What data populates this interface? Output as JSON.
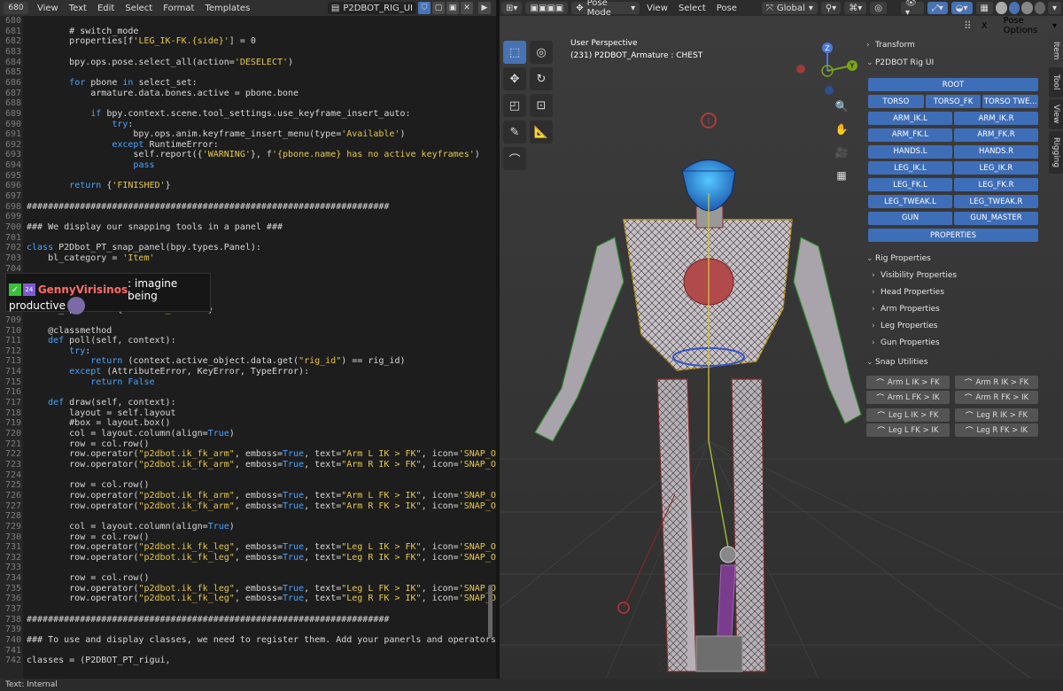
{
  "text_editor": {
    "editor_type": "680",
    "menu": [
      "View",
      "Text",
      "Edit",
      "Select",
      "Format",
      "Templates"
    ],
    "file_name": "P2DBOT_RIG_UI",
    "status": "Text: Internal",
    "lines": [
      {
        "n": "680",
        "t": ""
      },
      {
        "n": "681",
        "t": "        # switch_mode"
      },
      {
        "n": "682",
        "t": "        properties[f'LEG_IK-FK.{side}'] = 0"
      },
      {
        "n": "683",
        "t": ""
      },
      {
        "n": "684",
        "t": "        bpy.ops.pose.select_all(action='DESELECT')"
      },
      {
        "n": "685",
        "t": ""
      },
      {
        "n": "686",
        "t": "        for pbone in select_set:"
      },
      {
        "n": "687",
        "t": "            armature.data.bones.active = pbone.bone"
      },
      {
        "n": "688",
        "t": ""
      },
      {
        "n": "689",
        "t": "            if bpy.context.scene.tool_settings.use_keyframe_insert_auto:"
      },
      {
        "n": "690",
        "t": "                try:"
      },
      {
        "n": "691",
        "t": "                    bpy.ops.anim.keyframe_insert_menu(type='Available')"
      },
      {
        "n": "692",
        "t": "                except RuntimeError:"
      },
      {
        "n": "693",
        "t": "                    self.report({'WARNING'}, f'{pbone.name} has no active keyframes')"
      },
      {
        "n": "694",
        "t": "                    pass"
      },
      {
        "n": "695",
        "t": ""
      },
      {
        "n": "696",
        "t": "        return {'FINISHED'}"
      },
      {
        "n": "697",
        "t": ""
      },
      {
        "n": "698",
        "t": "####################################################################"
      },
      {
        "n": "699",
        "t": ""
      },
      {
        "n": "700",
        "t": "### We display our snapping tools in a panel ###"
      },
      {
        "n": "701",
        "t": ""
      },
      {
        "n": "702",
        "t": "class P2Dbot_PT_snap_panel(bpy.types.Panel):"
      },
      {
        "n": "703",
        "t": "    bl_category = 'Item'"
      },
      {
        "n": "704",
        "t": ""
      },
      {
        "n": "705",
        "t": ""
      },
      {
        "n": "706",
        "t": ""
      },
      {
        "n": "707",
        "t": "    bl_region_type = 'UI'"
      },
      {
        "n": "708",
        "t": "    bl_options = {'DEFAULT_CLOSED'}"
      },
      {
        "n": "709",
        "t": ""
      },
      {
        "n": "710",
        "t": "    @classmethod"
      },
      {
        "n": "711",
        "t": "    def poll(self, context):"
      },
      {
        "n": "712",
        "t": "        try:"
      },
      {
        "n": "713",
        "t": "            return (context.active_object.data.get(\"rig_id\") == rig_id)"
      },
      {
        "n": "714",
        "t": "        except (AttributeError, KeyError, TypeError):"
      },
      {
        "n": "715",
        "t": "            return False"
      },
      {
        "n": "716",
        "t": ""
      },
      {
        "n": "717",
        "t": "    def draw(self, context):"
      },
      {
        "n": "718",
        "t": "        layout = self.layout"
      },
      {
        "n": "719",
        "t": "        #box = layout.box()"
      },
      {
        "n": "720",
        "t": "        col = layout.column(align=True)"
      },
      {
        "n": "721",
        "t": "        row = col.row()"
      },
      {
        "n": "722",
        "t": "        row.operator(\"p2dbot.ik_fk_arm\", emboss=True, text=\"Arm L IK > FK\", icon='SNAP_ON').side"
      },
      {
        "n": "723",
        "t": "        row.operator(\"p2dbot.ik_fk_arm\", emboss=True, text=\"Arm R IK > FK\", icon='SNAP_ON').side"
      },
      {
        "n": "724",
        "t": ""
      },
      {
        "n": "725",
        "t": "        row = col.row()"
      },
      {
        "n": "726",
        "t": "        row.operator(\"p2dbot.ik_fk_arm\", emboss=True, text=\"Arm L FK > IK\", icon='SNAP_ON').side"
      },
      {
        "n": "727",
        "t": "        row.operator(\"p2dbot.ik_fk_arm\", emboss=True, text=\"Arm R FK > IK\", icon='SNAP_ON').side"
      },
      {
        "n": "728",
        "t": ""
      },
      {
        "n": "729",
        "t": "        col = layout.column(align=True)"
      },
      {
        "n": "730",
        "t": "        row = col.row()"
      },
      {
        "n": "731",
        "t": "        row.operator(\"p2dbot.ik_fk_leg\", emboss=True, text=\"Leg L IK > FK\", icon='SNAP_ON').side"
      },
      {
        "n": "732",
        "t": "        row.operator(\"p2dbot.ik_fk_leg\", emboss=True, text=\"Leg R IK > FK\", icon='SNAP_ON').side"
      },
      {
        "n": "733",
        "t": ""
      },
      {
        "n": "734",
        "t": "        row = col.row()"
      },
      {
        "n": "735",
        "t": "        row.operator(\"p2dbot.ik_fk_leg\", emboss=True, text=\"Leg L FK > IK\", icon='SNAP_ON').side"
      },
      {
        "n": "736",
        "t": "        row.operator(\"p2dbot.ik_fk_leg\", emboss=True, text=\"Leg R FK > IK\", icon='SNAP_ON').side"
      },
      {
        "n": "737",
        "t": ""
      },
      {
        "n": "738",
        "t": "####################################################################"
      },
      {
        "n": "739",
        "t": ""
      },
      {
        "n": "740",
        "t": "### To use and display classes, we need to register them. Add your panerls and operators to the"
      },
      {
        "n": "741",
        "t": ""
      },
      {
        "n": "742",
        "t": "classes = (P2DBOT_PT_rigui,"
      }
    ]
  },
  "chat": {
    "username": "GennyVirisinos",
    "message": ": imagine being",
    "message2": "productive",
    "badge2": "24"
  },
  "viewport": {
    "mode": "Pose Mode",
    "menu": [
      "View",
      "Select",
      "Pose"
    ],
    "orientation": "Global",
    "pose_options": "Pose Options",
    "perspective": "User Perspective",
    "object_info": "(231) P2DBOT_Armature : CHEST",
    "gizmo": {
      "z": "Z",
      "y": "Y"
    },
    "tabs": [
      "Item",
      "Tool",
      "View",
      "Rigging"
    ]
  },
  "panel": {
    "transform": "Transform",
    "rig_ui": "P2DBOT Rig UI",
    "root": "ROOT",
    "row1": [
      "TORSO",
      "TORSO_FK",
      "TORSO TWE..."
    ],
    "rows": [
      [
        "ARM_IK.L",
        "ARM_IK.R"
      ],
      [
        "ARM_FK.L",
        "ARM_FK.R"
      ],
      [
        "HANDS.L",
        "HANDS.R"
      ],
      [
        "LEG_IK.L",
        "LEG_IK.R"
      ],
      [
        "LEG_FK.L",
        "LEG_FK.R"
      ],
      [
        "LEG_TWEAK.L",
        "LEG_TWEAK.R"
      ],
      [
        "GUN",
        "GUN_MASTER"
      ]
    ],
    "properties": "PROPERTIES",
    "rig_properties": "Rig Properties",
    "subs": [
      "Visibility Properties",
      "Head Properties",
      "Arm Properties",
      "Leg Properties",
      "Gun Properties"
    ],
    "snap_utilities": "Snap Utilities",
    "snap": [
      [
        "Arm L IK > FK",
        "Arm R IK > FK"
      ],
      [
        "Arm L FK > IK",
        "Arm R FK > IK"
      ],
      [
        "Leg L IK > FK",
        "Leg R IK > FK"
      ],
      [
        "Leg L FK > IK",
        "Leg R FK > IK"
      ]
    ]
  }
}
